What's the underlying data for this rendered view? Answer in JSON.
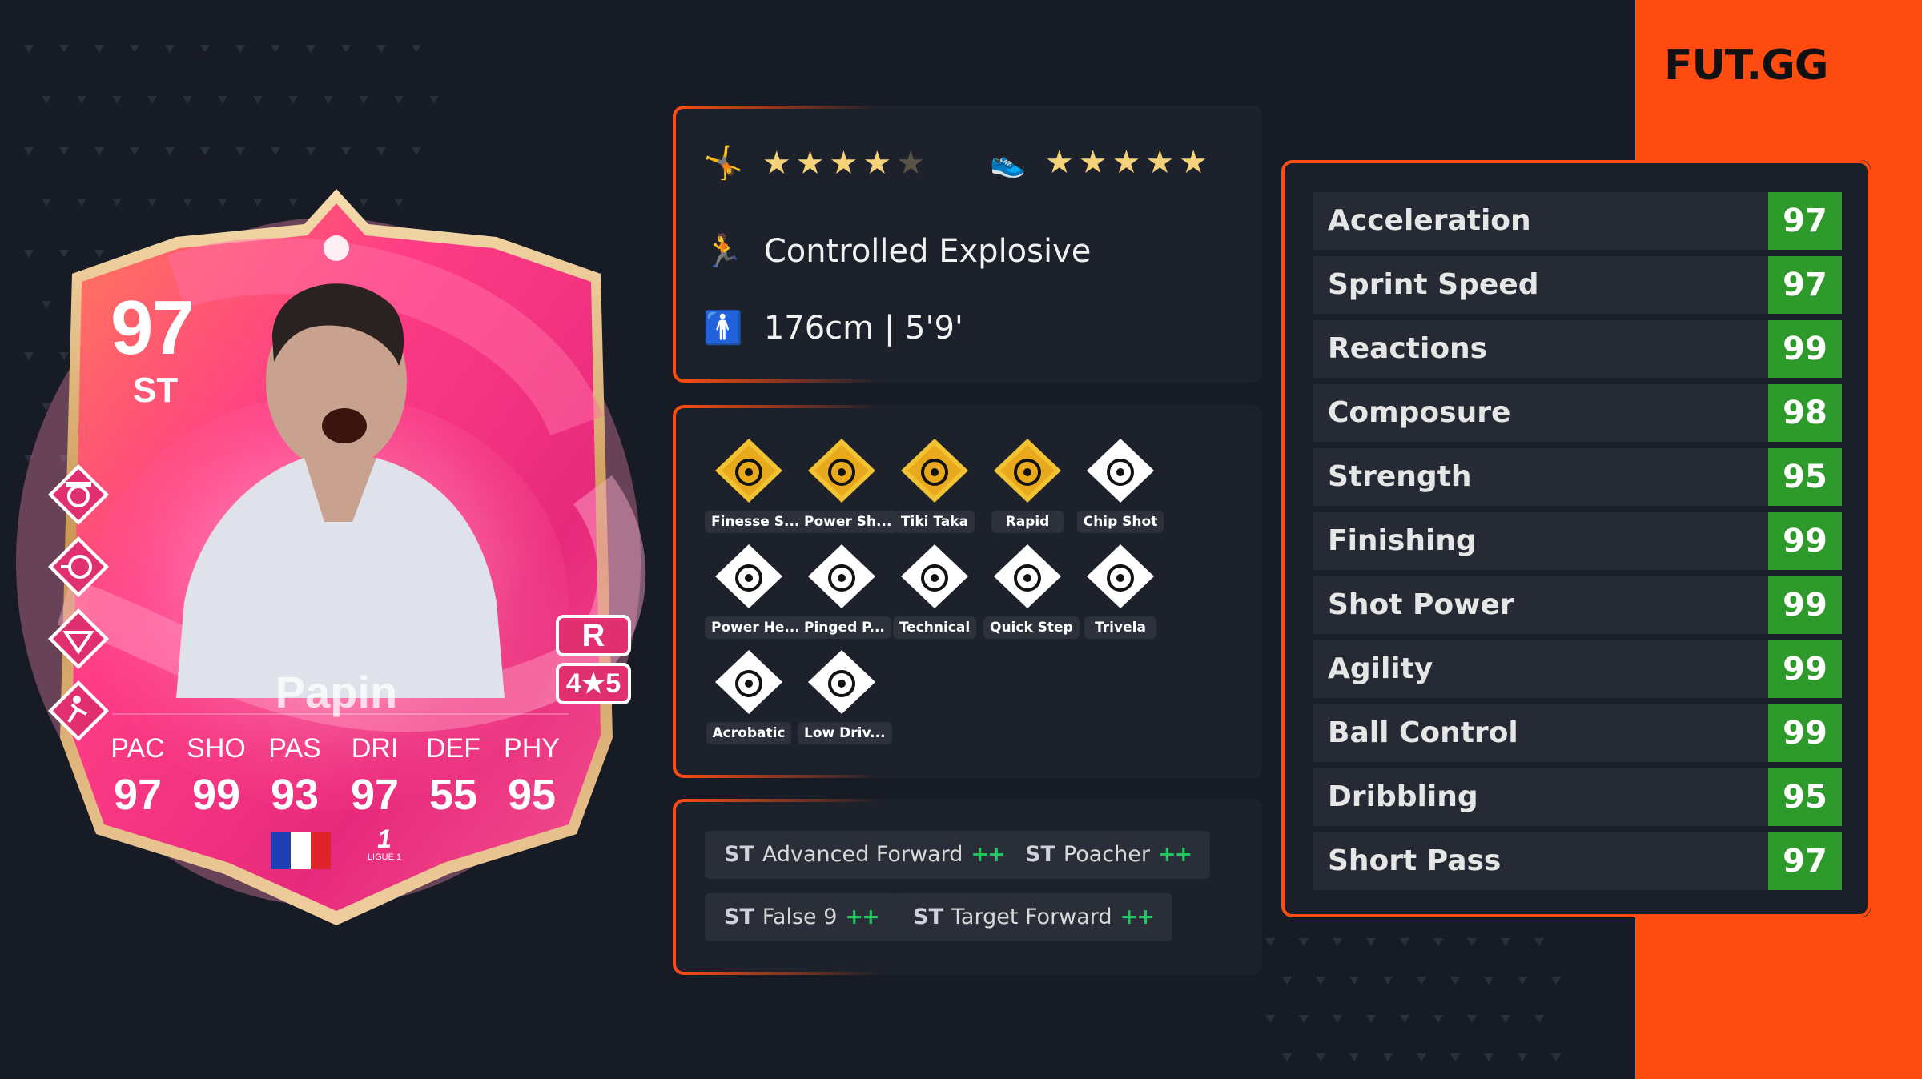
{
  "brand": {
    "logo": "FUT.GG",
    "accent": "#ff4d12"
  },
  "card": {
    "rating": "97",
    "position": "ST",
    "name": "Papin",
    "attributes": [
      {
        "label": "PAC",
        "value": "97"
      },
      {
        "label": "SHO",
        "value": "99"
      },
      {
        "label": "PAS",
        "value": "93"
      },
      {
        "label": "DRI",
        "value": "97"
      },
      {
        "label": "DEF",
        "value": "55"
      },
      {
        "label": "PHY",
        "value": "95"
      }
    ],
    "foot": "R",
    "skill_weak": "4★5",
    "nation": "France",
    "league_text": "LIGUE 1",
    "league_logo_glyph": "1",
    "side_playstyle_icons": [
      "finesse-shot-plus-icon",
      "power-shot-plus-icon",
      "tiki-taka-plus-icon",
      "rapid-plus-icon"
    ],
    "primary_color": "#e63a7a"
  },
  "info": {
    "skill_moves_stars": 4,
    "weak_foot_stars": 5,
    "max_stars": 5,
    "accelerate": "Controlled Explosive",
    "height": "176cm | 5'9'"
  },
  "playstyles_plus": [
    {
      "label": "Finesse S...",
      "icon": "finesse-shot-icon"
    },
    {
      "label": "Power Sh...",
      "icon": "power-shot-icon"
    },
    {
      "label": "Tiki Taka",
      "icon": "tiki-taka-icon"
    },
    {
      "label": "Rapid",
      "icon": "rapid-icon"
    }
  ],
  "playstyles": [
    {
      "label": "Chip Shot",
      "icon": "chip-shot-icon"
    },
    {
      "label": "Power He...",
      "icon": "power-header-icon"
    },
    {
      "label": "Pinged P...",
      "icon": "pinged-pass-icon"
    },
    {
      "label": "Technical",
      "icon": "technical-icon"
    },
    {
      "label": "Quick Step",
      "icon": "quick-step-icon"
    },
    {
      "label": "Trivela",
      "icon": "trivela-icon"
    },
    {
      "label": "Acrobatic",
      "icon": "acrobatic-icon"
    },
    {
      "label": "Low Driv...",
      "icon": "low-driven-shot-icon"
    }
  ],
  "roles": [
    {
      "pos": "ST",
      "name": "Advanced Forward",
      "plus": "++"
    },
    {
      "pos": "ST",
      "name": "Poacher",
      "plus": "++"
    },
    {
      "pos": "ST",
      "name": "False 9",
      "plus": "++"
    },
    {
      "pos": "ST",
      "name": "Target Forward",
      "plus": "++"
    }
  ],
  "stats": [
    {
      "name": "Acceleration",
      "value": "97"
    },
    {
      "name": "Sprint Speed",
      "value": "97"
    },
    {
      "name": "Reactions",
      "value": "99"
    },
    {
      "name": "Composure",
      "value": "98"
    },
    {
      "name": "Strength",
      "value": "95"
    },
    {
      "name": "Finishing",
      "value": "99"
    },
    {
      "name": "Shot Power",
      "value": "99"
    },
    {
      "name": "Agility",
      "value": "99"
    },
    {
      "name": "Ball Control",
      "value": "99"
    },
    {
      "name": "Dribbling",
      "value": "95"
    },
    {
      "name": "Short Pass",
      "value": "97"
    }
  ]
}
